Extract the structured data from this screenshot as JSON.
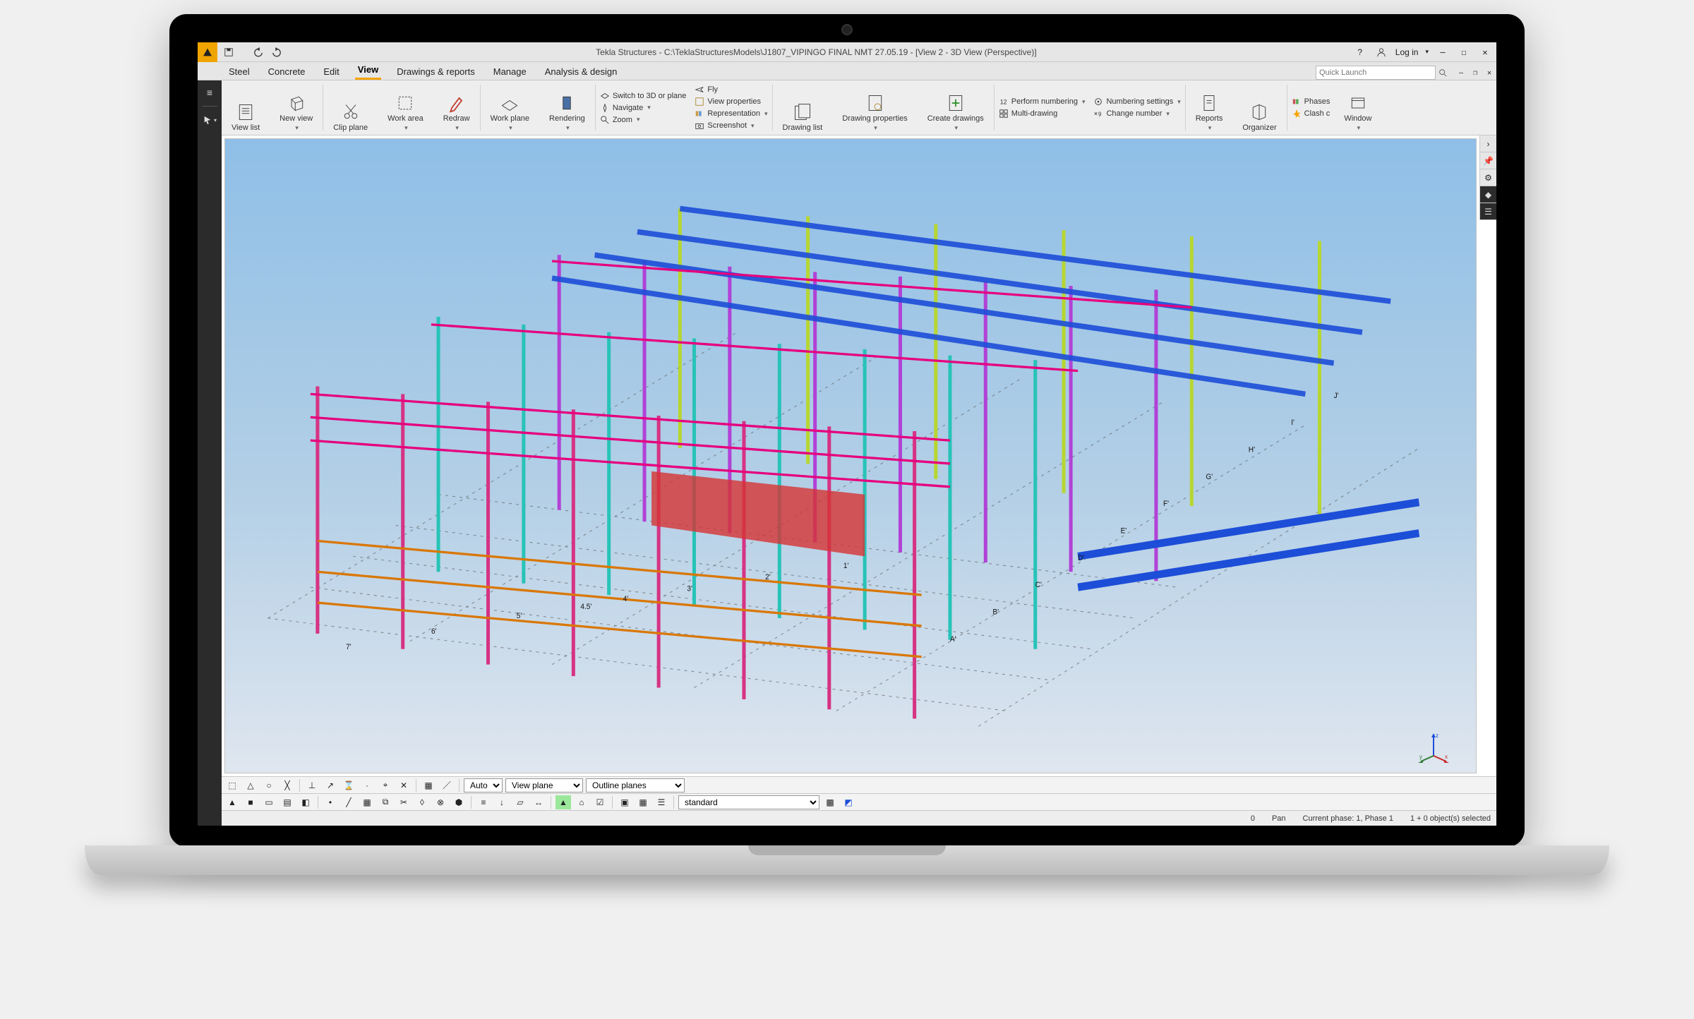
{
  "titlebar": {
    "title": "Tekla Structures - C:\\TeklaStructuresModels\\J1807_VIPINGO FINAL NMT 27.05.19  - [View 2 - 3D View (Perspective)]",
    "login": "Log in"
  },
  "menu": {
    "items": [
      "Steel",
      "Concrete",
      "Edit",
      "View",
      "Drawings & reports",
      "Manage",
      "Analysis & design"
    ],
    "active_index": 3,
    "quick_launch_placeholder": "Quick Launch"
  },
  "ribbon": {
    "groups": {
      "view_list": "View list",
      "new_view": "New view",
      "clip_plane": "Clip plane",
      "work_area": "Work area",
      "redraw": "Redraw",
      "work_plane": "Work plane",
      "rendering": "Rendering"
    },
    "stack_a": {
      "switch": "Switch to 3D or plane",
      "navigate": "Navigate",
      "zoom": "Zoom"
    },
    "stack_b": {
      "fly": "Fly",
      "view_props": "View properties",
      "representation": "Representation",
      "screenshot": "Screenshot"
    },
    "draw": {
      "drawing_list": "Drawing list",
      "drawing_properties": "Drawing properties",
      "create_drawings": "Create drawings"
    },
    "stack_c": {
      "perform_numbering": "Perform numbering",
      "multi_drawing": "Multi-drawing"
    },
    "stack_d": {
      "numbering_settings": "Numbering settings",
      "change_number": "Change number"
    },
    "right": {
      "reports": "Reports",
      "organizer": "Organizer",
      "phases": "Phases",
      "clash": "Clash c",
      "window": "Window"
    }
  },
  "bottom_toolbar_a": {
    "select_auto": "Auto",
    "select_plane": "View plane",
    "select_outline": "Outline planes"
  },
  "bottom_toolbar_b": {
    "select_standard": "standard"
  },
  "statusbar": {
    "zero": "0",
    "pan": "Pan",
    "phase": "Current phase: 1, Phase 1",
    "selection": "1 + 0 object(s) selected"
  },
  "grid_labels": {
    "letters": [
      "A'",
      "B'",
      "C'",
      "D'",
      "E'",
      "F'",
      "G'",
      "H'",
      "I'",
      "J'"
    ],
    "numbers": [
      "1'",
      "2'",
      "3'",
      "4'",
      "4.5'",
      "5'",
      "6'",
      "7'"
    ]
  },
  "axis_gizmo": {
    "z": "z",
    "x": "x",
    "y": "y"
  }
}
